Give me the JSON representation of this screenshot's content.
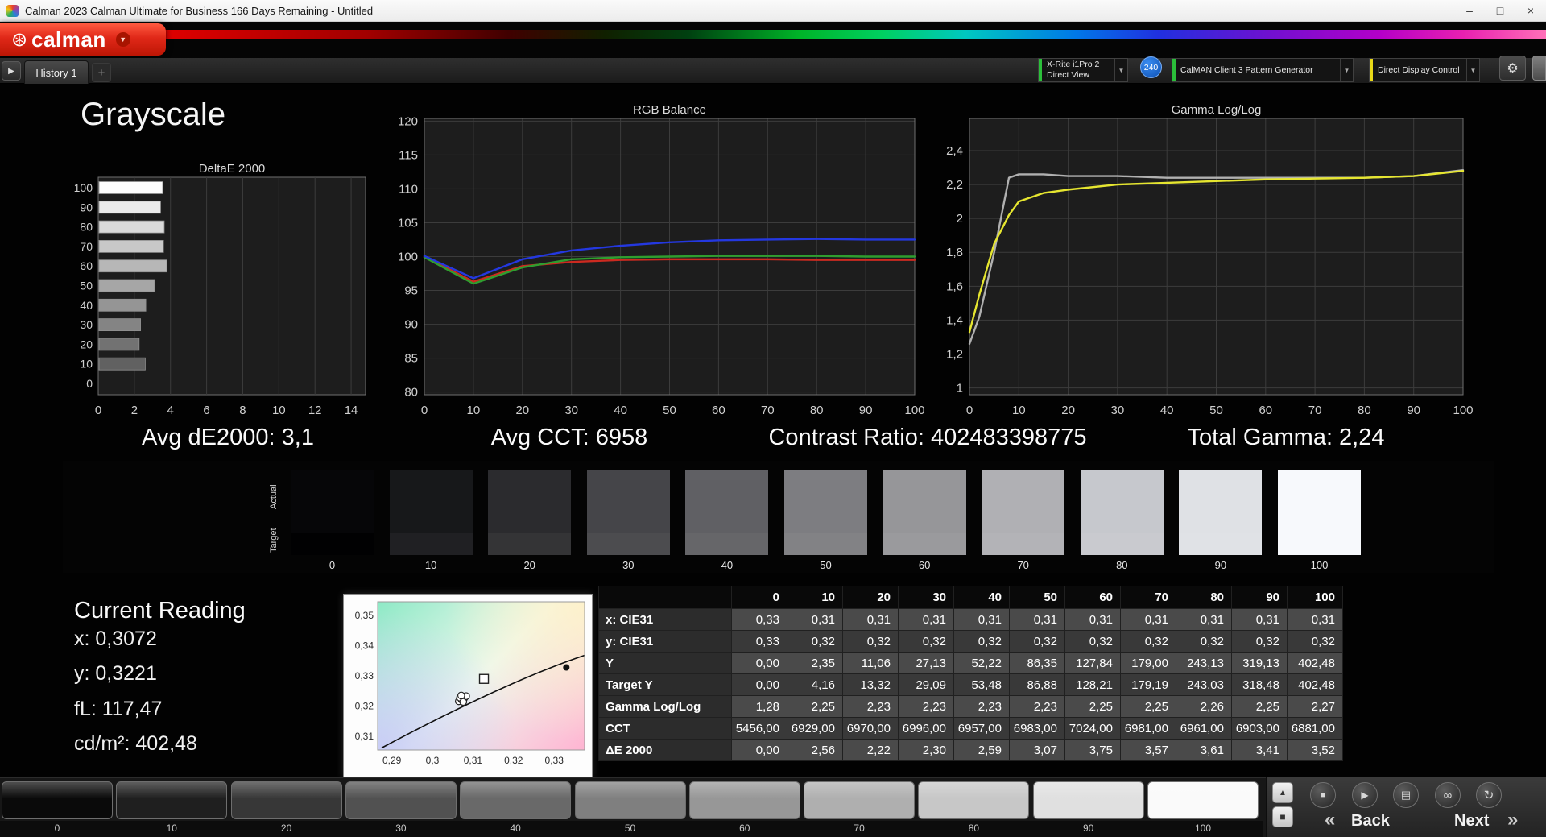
{
  "window": {
    "title": "Calman 2023 Calman Ultimate for Business 166 Days Remaining  - Untitled"
  },
  "brand": {
    "name": "calman"
  },
  "toolbar": {
    "history_tab": "History 1",
    "meter_line1": "X-Rite i1Pro 2",
    "meter_line2": "Direct View",
    "meter_badge": "240",
    "pattern_generator": "CalMAN Client 3 Pattern Generator",
    "display_control": "Direct Display Control"
  },
  "colors": {
    "meter_accent": "#2bbf3a",
    "pattern_accent": "#2bbf3a",
    "display_accent": "#e8d818",
    "badge_bg": "#1566c8",
    "logo_red": "#e02818"
  },
  "icons": {
    "logo_mark": "⊛",
    "logo_caret": "▼",
    "history_toggle": "▶",
    "tab_add": "+",
    "dd_caret": "▼",
    "gear": "⚙",
    "minimize": "–",
    "maximize": "□",
    "close": "×",
    "eject": "▲",
    "display_square": "■",
    "stop": "■",
    "play": "▶",
    "save": "▤",
    "loop": "∞",
    "refresh": "↻",
    "back_chevrons": "«",
    "next_chevrons": "»"
  },
  "page_title": "Grayscale",
  "stats": {
    "avg_de": "Avg dE2000: 3,1",
    "avg_cct": "Avg CCT: 6958",
    "contrast": "Contrast Ratio: 402483398775",
    "total_gamma": "Total Gamma: 2,24"
  },
  "current_reading": {
    "title": "Current Reading",
    "x": "x: 0,3072",
    "y": "y: 0,3221",
    "fl": "fL: 117,47",
    "cdm2": "cd/m²: 402,48"
  },
  "swatches": {
    "actual_label": "Actual",
    "target_label": "Target",
    "levels": [
      "0",
      "10",
      "20",
      "30",
      "40",
      "50",
      "60",
      "70",
      "80",
      "90",
      "100"
    ],
    "actual_colors": [
      "#060608",
      "#17181a",
      "#2b2b2e",
      "#454549",
      "#606064",
      "#7d7d81",
      "#969699",
      "#b0b0b4",
      "#c6c8cd",
      "#dfe1e5",
      "#f7f9fc"
    ],
    "target_colors": [
      "#010102",
      "#202023",
      "#343436",
      "#4c4c4f",
      "#666669",
      "#828285",
      "#9a9a9d",
      "#b3b3b7",
      "#c9cacf",
      "#e0e2e6",
      "#f7f9fc"
    ]
  },
  "table": {
    "columns": [
      "0",
      "10",
      "20",
      "30",
      "40",
      "50",
      "60",
      "70",
      "80",
      "90",
      "100"
    ],
    "rows": [
      {
        "label": "x: CIE31",
        "values": [
          "0,33",
          "0,31",
          "0,31",
          "0,31",
          "0,31",
          "0,31",
          "0,31",
          "0,31",
          "0,31",
          "0,31",
          "0,31"
        ]
      },
      {
        "label": "y: CIE31",
        "values": [
          "0,33",
          "0,32",
          "0,32",
          "0,32",
          "0,32",
          "0,32",
          "0,32",
          "0,32",
          "0,32",
          "0,32",
          "0,32"
        ]
      },
      {
        "label": "Y",
        "values": [
          "0,00",
          "2,35",
          "11,06",
          "27,13",
          "52,22",
          "86,35",
          "127,84",
          "179,00",
          "243,13",
          "319,13",
          "402,48"
        ]
      },
      {
        "label": "Target Y",
        "values": [
          "0,00",
          "4,16",
          "13,32",
          "29,09",
          "53,48",
          "86,88",
          "128,21",
          "179,19",
          "243,03",
          "318,48",
          "402,48"
        ]
      },
      {
        "label": "Gamma Log/Log",
        "values": [
          "1,28",
          "2,25",
          "2,23",
          "2,23",
          "2,23",
          "2,23",
          "2,25",
          "2,25",
          "2,26",
          "2,25",
          "2,27"
        ]
      },
      {
        "label": "CCT",
        "values": [
          "5456,00",
          "6929,00",
          "6970,00",
          "6996,00",
          "6957,00",
          "6983,00",
          "7024,00",
          "6981,00",
          "6961,00",
          "6903,00",
          "6881,00"
        ]
      },
      {
        "label": "ΔE 2000",
        "values": [
          "0,00",
          "2,56",
          "2,22",
          "2,30",
          "2,59",
          "3,07",
          "3,75",
          "3,57",
          "3,61",
          "3,41",
          "3,52"
        ]
      }
    ]
  },
  "bottom_bar": {
    "levels": [
      "0",
      "10",
      "20",
      "30",
      "40",
      "50",
      "60",
      "70",
      "80",
      "90",
      "100"
    ],
    "colors": [
      "#0a0a0a",
      "#1f1f1f",
      "#373737",
      "#515151",
      "#696969",
      "#7f7f7f",
      "#979797",
      "#afafaf",
      "#c7c7c7",
      "#e0e0e0",
      "#fafafa"
    ],
    "back_label": "Back",
    "next_label": "Next"
  },
  "chart_data": [
    {
      "type": "bar",
      "title": "DeltaE 2000",
      "orientation": "horizontal",
      "categories": [
        100,
        90,
        80,
        70,
        60,
        50,
        40,
        30,
        20,
        10,
        0
      ],
      "values": [
        3.52,
        3.41,
        3.61,
        3.57,
        3.75,
        3.07,
        2.59,
        2.3,
        2.22,
        2.56,
        0.0
      ],
      "xlim": [
        0,
        14.8
      ],
      "xticks": [
        0,
        2,
        4,
        6,
        8,
        10,
        12,
        14
      ]
    },
    {
      "type": "line",
      "title": "RGB Balance",
      "x": [
        0,
        10,
        20,
        30,
        40,
        50,
        60,
        70,
        80,
        90,
        100
      ],
      "series": [
        {
          "name": "red",
          "color": "#cc2a20",
          "values": [
            100.0,
            96.3,
            98.6,
            99.2,
            99.5,
            99.6,
            99.6,
            99.6,
            99.5,
            99.5,
            99.5
          ]
        },
        {
          "name": "green",
          "color": "#2f9e2f",
          "values": [
            99.9,
            96.0,
            98.4,
            99.6,
            99.9,
            100.0,
            100.1,
            100.1,
            100.1,
            100.0,
            100.0
          ]
        },
        {
          "name": "blue",
          "color": "#2438e0",
          "values": [
            100.1,
            96.8,
            99.6,
            100.9,
            101.6,
            102.1,
            102.4,
            102.5,
            102.6,
            102.5,
            102.5
          ]
        }
      ],
      "xlim": [
        0,
        100
      ],
      "xticks": [
        0,
        10,
        20,
        30,
        40,
        50,
        60,
        70,
        80,
        90,
        100
      ],
      "ylim": [
        79.6,
        120.4
      ],
      "yticks": [
        120,
        115,
        110,
        105,
        100,
        95,
        90,
        85,
        80
      ]
    },
    {
      "type": "line",
      "title": "Gamma Log/Log",
      "x": [
        0,
        2,
        5,
        8,
        10,
        15,
        20,
        30,
        40,
        50,
        60,
        70,
        80,
        90,
        100
      ],
      "series": [
        {
          "name": "reference",
          "color": "#b0b0b0",
          "values": [
            1.26,
            1.42,
            1.8,
            2.24,
            2.26,
            2.26,
            2.25,
            2.25,
            2.24,
            2.24,
            2.24,
            2.24,
            2.24,
            2.25,
            2.285
          ]
        },
        {
          "name": "measured",
          "color": "#e6e630",
          "values": [
            1.33,
            1.55,
            1.85,
            2.02,
            2.1,
            2.15,
            2.17,
            2.2,
            2.21,
            2.22,
            2.23,
            2.235,
            2.24,
            2.25,
            2.28
          ]
        }
      ],
      "xlim": [
        0,
        100
      ],
      "xticks": [
        0,
        10,
        20,
        30,
        40,
        50,
        60,
        70,
        80,
        90,
        100
      ],
      "ylim": [
        0.96,
        2.59
      ],
      "yticks": [
        2.4,
        2.2,
        2.0,
        1.8,
        1.6,
        1.4,
        1.2,
        1.0
      ],
      "ytick_labels": [
        "2,4",
        "2,2",
        "2",
        "1,8",
        "1,6",
        "1,4",
        "1,2",
        "1"
      ]
    },
    {
      "type": "scatter",
      "title": "CIE 1931 xy",
      "xlim": [
        0.2865,
        0.3375
      ],
      "ylim": [
        0.3055,
        0.3545
      ],
      "xticks": [
        0.29,
        0.3,
        0.31,
        0.32,
        0.33
      ],
      "xtick_labels": [
        "0,29",
        "0,3",
        "0,31",
        "0,32",
        "0,33"
      ],
      "yticks": [
        0.35,
        0.34,
        0.33,
        0.32,
        0.31
      ],
      "ytick_labels": [
        "0,35",
        "0,34",
        "0,33",
        "0,32",
        "0,31"
      ],
      "points": [
        [
          0.3065,
          0.3216
        ],
        [
          0.3072,
          0.3221
        ],
        [
          0.3079,
          0.3227
        ],
        [
          0.3068,
          0.3228
        ],
        [
          0.3076,
          0.3214
        ],
        [
          0.3083,
          0.3233
        ],
        [
          0.3071,
          0.3235
        ]
      ],
      "target": [
        0.3127,
        0.329
      ],
      "ref_point": [
        0.333,
        0.3328
      ],
      "locus": [
        [
          0.2875,
          0.3062
        ],
        [
          0.318,
          0.328
        ],
        [
          0.3375,
          0.3368
        ]
      ]
    }
  ]
}
